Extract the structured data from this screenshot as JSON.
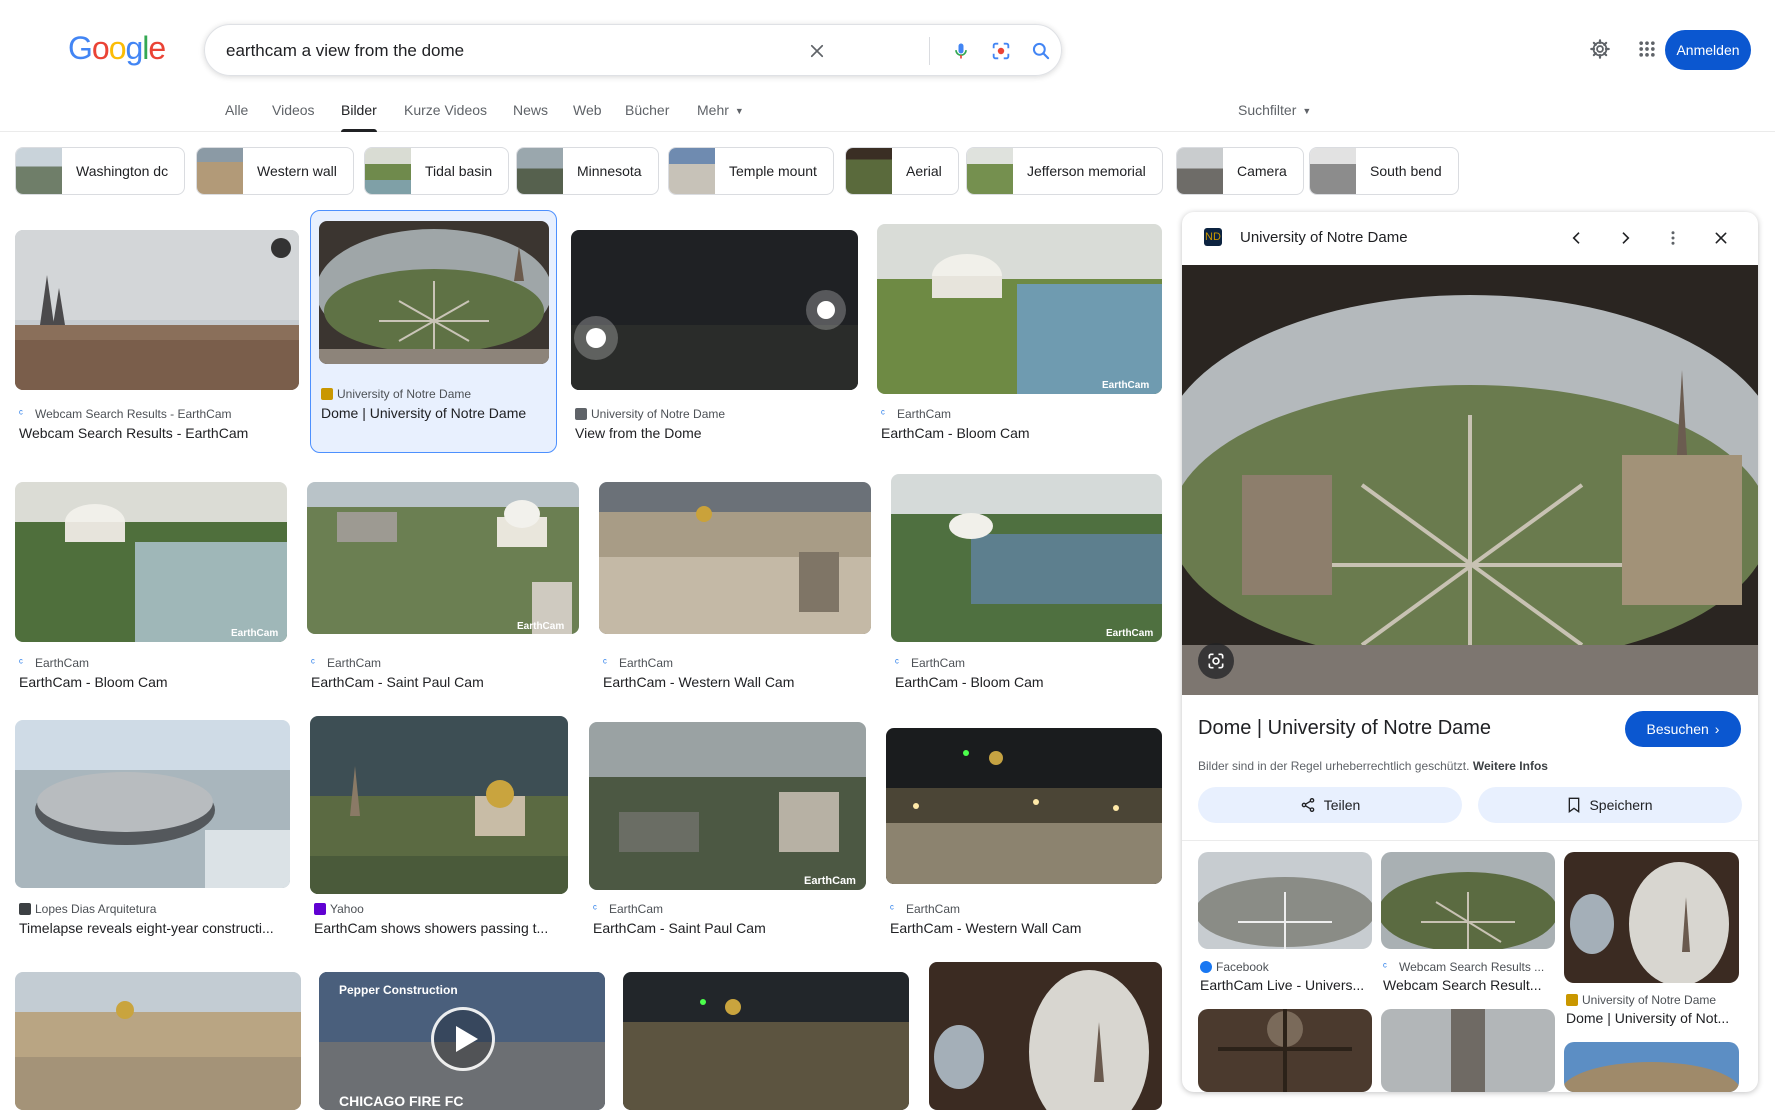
{
  "search": {
    "query": "earthcam a view from the dome"
  },
  "header": {
    "signin_label": "Anmelden"
  },
  "tabs": [
    {
      "label": "Alle"
    },
    {
      "label": "Videos"
    },
    {
      "label": "Bilder"
    },
    {
      "label": "Kurze Videos"
    },
    {
      "label": "News"
    },
    {
      "label": "Web"
    },
    {
      "label": "Bücher"
    },
    {
      "label": "Mehr"
    }
  ],
  "tools_label": "Suchfilter",
  "chips": [
    {
      "label": "Washington dc"
    },
    {
      "label": "Western wall"
    },
    {
      "label": "Tidal basin"
    },
    {
      "label": "Minnesota"
    },
    {
      "label": "Temple mount"
    },
    {
      "label": "Aerial"
    },
    {
      "label": "Jefferson memorial"
    },
    {
      "label": "Camera"
    },
    {
      "label": "South bend"
    }
  ],
  "results": [
    {
      "source": "Webcam Search Results - EarthCam",
      "title": "Webcam Search Results - EarthCam"
    },
    {
      "source": "University of Notre Dame",
      "title": "Dome | University of Notre Dame"
    },
    {
      "source": "University of Notre Dame",
      "title": "View from the Dome"
    },
    {
      "source": "EarthCam",
      "title": "EarthCam - Bloom Cam"
    },
    {
      "source": "EarthCam",
      "title": "EarthCam - Bloom Cam"
    },
    {
      "source": "EarthCam",
      "title": "EarthCam - Saint Paul Cam"
    },
    {
      "source": "EarthCam",
      "title": "EarthCam - Western Wall Cam"
    },
    {
      "source": "EarthCam",
      "title": "EarthCam - Bloom Cam"
    },
    {
      "source": "Lopes Dias Arquitetura",
      "title": "Timelapse reveals eight-year constructi..."
    },
    {
      "source": "Yahoo",
      "title": "EarthCam shows showers passing t..."
    },
    {
      "source": "EarthCam",
      "title": "EarthCam - Saint Paul Cam"
    },
    {
      "source": "EarthCam",
      "title": "EarthCam - Western Wall Cam"
    }
  ],
  "thumb_text": {
    "earthcam_watermark": "EarthCam",
    "pepper": "Pepper Construction",
    "chicago": "CHICAGO FIRE FC"
  },
  "panel": {
    "site": "University of Notre Dame",
    "title": "Dome | University of Notre Dame",
    "visit_label": "Besuchen",
    "copyright": "Bilder sind in der Regel urheberrechtlich geschützt.",
    "more_info": "Weitere Infos",
    "share_label": "Teilen",
    "save_label": "Speichern",
    "related": [
      {
        "source": "Facebook",
        "title": "EarthCam Live - Univers..."
      },
      {
        "source": "Webcam Search Results ...",
        "title": "Webcam Search Result..."
      },
      {
        "source": "University of Notre Dame",
        "title": "Dome | University of Not..."
      }
    ]
  },
  "colors": {
    "accent": "#0b57d0",
    "selected_bg": "#e8f0fe",
    "selected_border": "#4d90fe"
  }
}
